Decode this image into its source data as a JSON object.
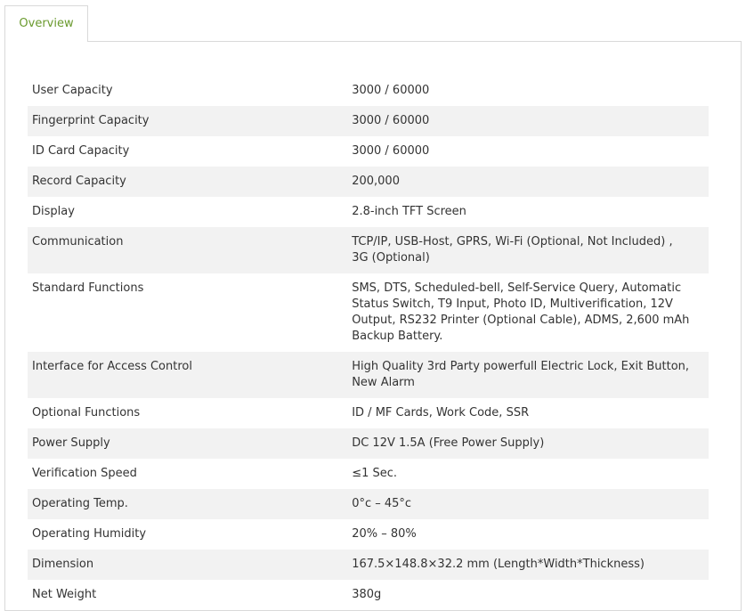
{
  "tabs": [
    {
      "label": "Overview",
      "active": true
    }
  ],
  "colors": {
    "tab_text": "#6a9a2e",
    "row_alt_bg": "#f2f2f2",
    "border": "#d9d9d9",
    "text": "#333333"
  },
  "specs": [
    {
      "label": "User Capacity",
      "value": "3000 / 60000"
    },
    {
      "label": "Fingerprint Capacity",
      "value": "3000 / 60000"
    },
    {
      "label": "ID Card Capacity",
      "value": "3000 / 60000"
    },
    {
      "label": "Record Capacity",
      "value": "200,000"
    },
    {
      "label": "Display",
      "value": "2.8-inch TFT Screen"
    },
    {
      "label": "Communication",
      "value": "TCP/IP, USB-Host, GPRS, Wi-Fi (Optional, Not Included) , 3G (Optional)"
    },
    {
      "label": "Standard Functions",
      "value": "SMS, DTS, Scheduled-bell, Self-Service Query, Automatic Status Switch, T9 Input, Photo ID, Multiverification, 12V Output, RS232 Printer (Optional Cable), ADMS, 2,600 mAh Backup Battery."
    },
    {
      "label": "Interface for Access Control",
      "value": "High Quality 3rd Party powerfull Electric Lock, Exit Button, New Alarm"
    },
    {
      "label": "Optional Functions",
      "value": "ID / MF Cards, Work Code, SSR"
    },
    {
      "label": "Power Supply",
      "value": "DC 12V 1.5A (Free Power Supply)"
    },
    {
      "label": "Verification Speed",
      "value": "≤1 Sec."
    },
    {
      "label": "Operating Temp.",
      "value": "0°c – 45°c"
    },
    {
      "label": "Operating Humidity",
      "value": "20% – 80%"
    },
    {
      "label": "Dimension",
      "value": "167.5×148.8×32.2 mm (Length*Width*Thickness)"
    },
    {
      "label": "Net Weight",
      "value": "380g"
    }
  ]
}
